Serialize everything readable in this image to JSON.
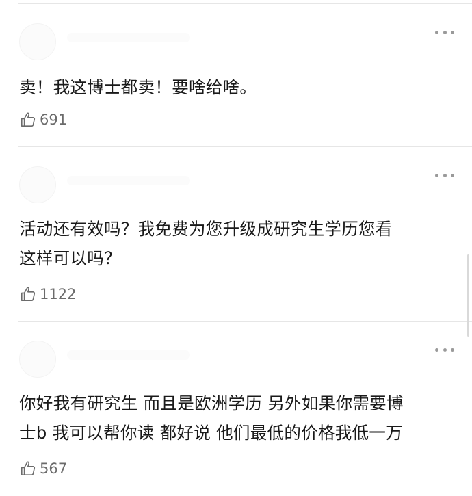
{
  "comments": [
    {
      "text_lines": [
        "卖！我这博士都卖！要啥给啥。"
      ],
      "like_count": "691",
      "like_icon": "thumbs-up-icon",
      "more_icon": "more-horizontal-icon"
    },
    {
      "text_lines": [
        "活动还有效吗？我免费为您升级成研究生学历您看",
        "这样可以吗？"
      ],
      "like_count": "1122",
      "like_icon": "thumbs-up-icon",
      "more_icon": "more-horizontal-icon"
    },
    {
      "text_lines": [
        "你好我有研究生 而且是欧洲学历 另外如果你需要博",
        "士b 我可以帮你读 都好说 他们最低的价格我低一万"
      ],
      "like_count": "567",
      "like_icon": "thumbs-up-icon",
      "more_icon": "more-horizontal-icon"
    }
  ],
  "colors": {
    "text": "#1a1a1a",
    "meta": "#6b6b6b",
    "divider": "#e6e6e6",
    "dots": "#9a9a9a"
  }
}
